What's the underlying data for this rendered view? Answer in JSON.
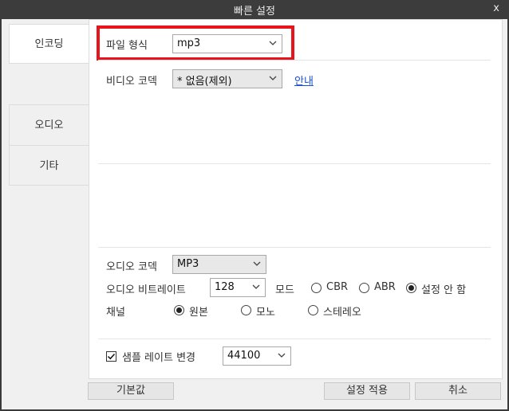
{
  "window": {
    "title": "빠른 설정",
    "close_label": "x"
  },
  "sidebar": {
    "items": [
      {
        "label": "인코딩"
      },
      {
        "label": "오디오"
      },
      {
        "label": "기타"
      }
    ]
  },
  "encoding": {
    "file_format_label": "파일 형식",
    "file_format_value": "mp3",
    "video_codec_label": "비디오 코덱",
    "video_codec_value": "* 없음(제외)",
    "guide_link": "안내"
  },
  "audio": {
    "codec_label": "오디오 코덱",
    "codec_value": "MP3",
    "bitrate_label": "오디오 비트레이트",
    "bitrate_value": "128",
    "mode_label": "모드",
    "mode_options": [
      {
        "label": "CBR",
        "selected": false
      },
      {
        "label": "ABR",
        "selected": false
      },
      {
        "label": "설정 안 함",
        "selected": true
      }
    ],
    "channel_label": "채널",
    "channel_options": [
      {
        "label": "원본",
        "selected": true
      },
      {
        "label": "모노",
        "selected": false
      },
      {
        "label": "스테레오",
        "selected": false
      }
    ],
    "sample_rate_label": "샘플 레이트 변경",
    "sample_rate_checked": true,
    "sample_rate_value": "44100"
  },
  "buttons": {
    "default": "기본값",
    "apply": "설정 적용",
    "cancel": "취소"
  },
  "colors": {
    "highlight": "#e8141b",
    "link": "#1a4fd8"
  }
}
